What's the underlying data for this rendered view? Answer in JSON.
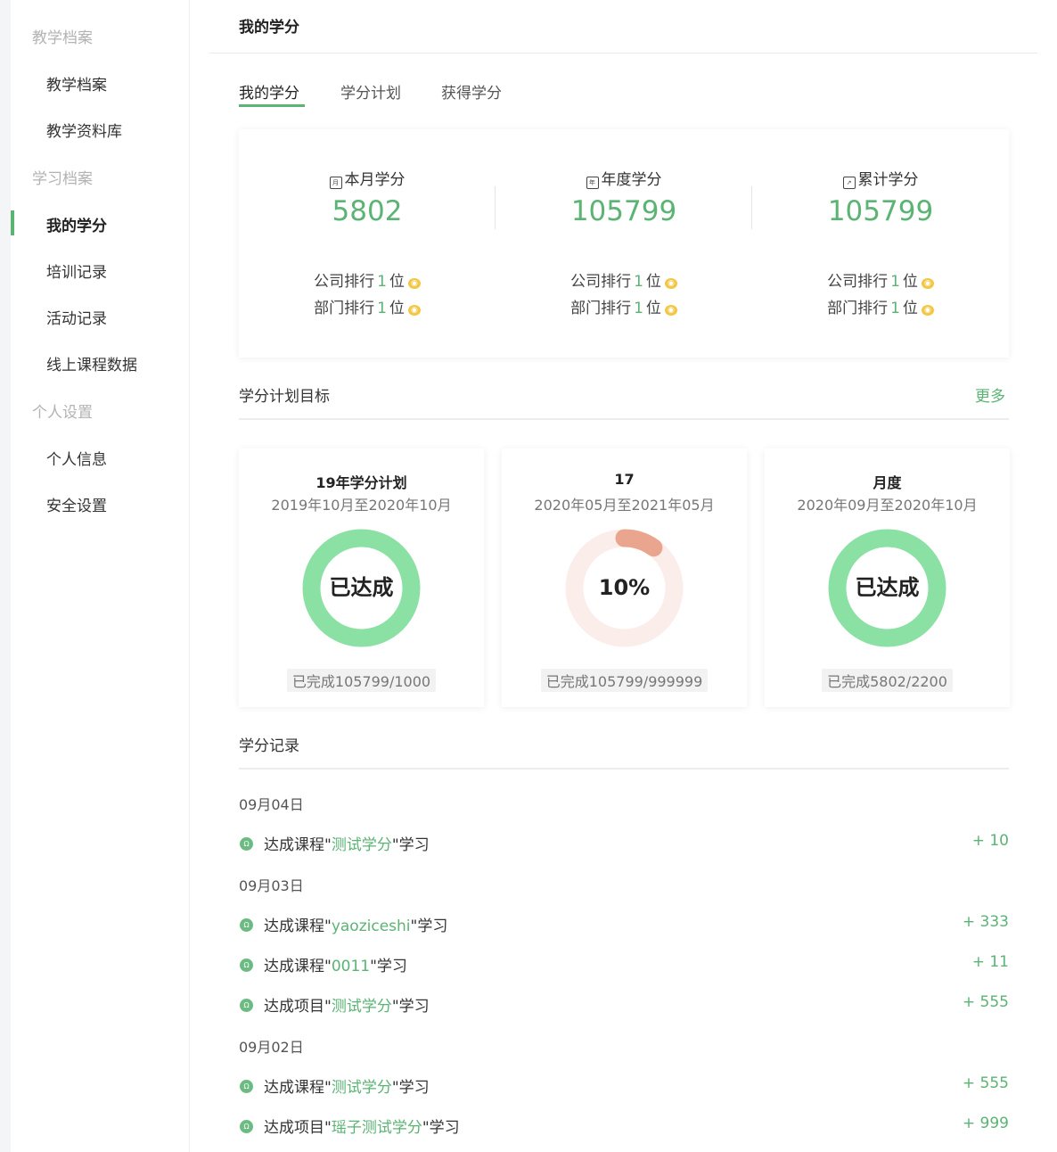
{
  "sidebar": {
    "groups": [
      {
        "label": "教学档案",
        "items": [
          "教学档案",
          "教学资料库"
        ]
      },
      {
        "label": "学习档案",
        "items": [
          "我的学分",
          "培训记录",
          "活动记录",
          "线上课程数据"
        ]
      },
      {
        "label": "个人设置",
        "items": [
          "个人信息",
          "安全设置"
        ]
      }
    ],
    "active_item": "我的学分"
  },
  "header": {
    "title": "我的学分"
  },
  "tabs": [
    {
      "label": "我的学分",
      "active": true
    },
    {
      "label": "学分计划",
      "active": false
    },
    {
      "label": "获得学分",
      "active": false
    }
  ],
  "summary": [
    {
      "icon": "calendar-month-icon",
      "icon_glyph": "月",
      "label": "本月学分",
      "value": "5802",
      "company_rank_label": "公司排行",
      "company_rank": "1",
      "dept_rank_label": "部门排行",
      "dept_rank": "1",
      "rank_unit": "位"
    },
    {
      "icon": "calendar-year-icon",
      "icon_glyph": "年",
      "label": "年度学分",
      "value": "105799",
      "company_rank_label": "公司排行",
      "company_rank": "1",
      "dept_rank_label": "部门排行",
      "dept_rank": "1",
      "rank_unit": "位"
    },
    {
      "icon": "cumulative-icon",
      "icon_glyph": "↗",
      "label": "累计学分",
      "value": "105799",
      "company_rank_label": "公司排行",
      "company_rank": "1",
      "dept_rank_label": "部门排行",
      "dept_rank": "1",
      "rank_unit": "位"
    }
  ],
  "plans_section": {
    "title": "学分计划目标",
    "more_label": "更多"
  },
  "plans": [
    {
      "name": "19年学分计划",
      "range": "2019年10月至2020年10月",
      "center_text": "已达成",
      "progress": 1.0,
      "completed": "已完成105799/1000",
      "status": "achieved"
    },
    {
      "name": "17",
      "range": "2020年05月至2021年05月",
      "center_text": "10%",
      "progress": 0.1,
      "completed": "已完成105799/999999",
      "status": "in_progress"
    },
    {
      "name": "月度",
      "range": "2020年09月至2020年10月",
      "center_text": "已达成",
      "progress": 1.0,
      "completed": "已完成5802/2200",
      "status": "achieved"
    }
  ],
  "records_section": {
    "title": "学分记录"
  },
  "records": [
    {
      "date": "09月04日",
      "items": [
        {
          "prefix": "达成课程\"",
          "name": "测试学分",
          "suffix": "\"学习",
          "score": "+ 10"
        }
      ]
    },
    {
      "date": "09月03日",
      "items": [
        {
          "prefix": "达成课程\"",
          "name": "yaoziceshi",
          "suffix": "\"学习",
          "score": "+ 333"
        },
        {
          "prefix": "达成课程\"",
          "name": "0011",
          "suffix": "\"学习",
          "score": "+ 11"
        },
        {
          "prefix": "达成项目\"",
          "name": "测试学分",
          "suffix": "\"学习",
          "score": "+ 555"
        }
      ]
    },
    {
      "date": "09月02日",
      "items": [
        {
          "prefix": "达成课程\"",
          "name": "测试学分",
          "suffix": "\"学习",
          "score": "+ 555"
        },
        {
          "prefix": "达成项目\"",
          "name": "瑶子测试学分",
          "suffix": "\"学习",
          "score": "+ 999"
        }
      ]
    }
  ],
  "colors": {
    "accent": "#5bb374",
    "ring_done": "#8be0a4",
    "ring_progress": "#eaa58f",
    "ring_track": "#fbeeea",
    "medal": "#f2c744"
  }
}
